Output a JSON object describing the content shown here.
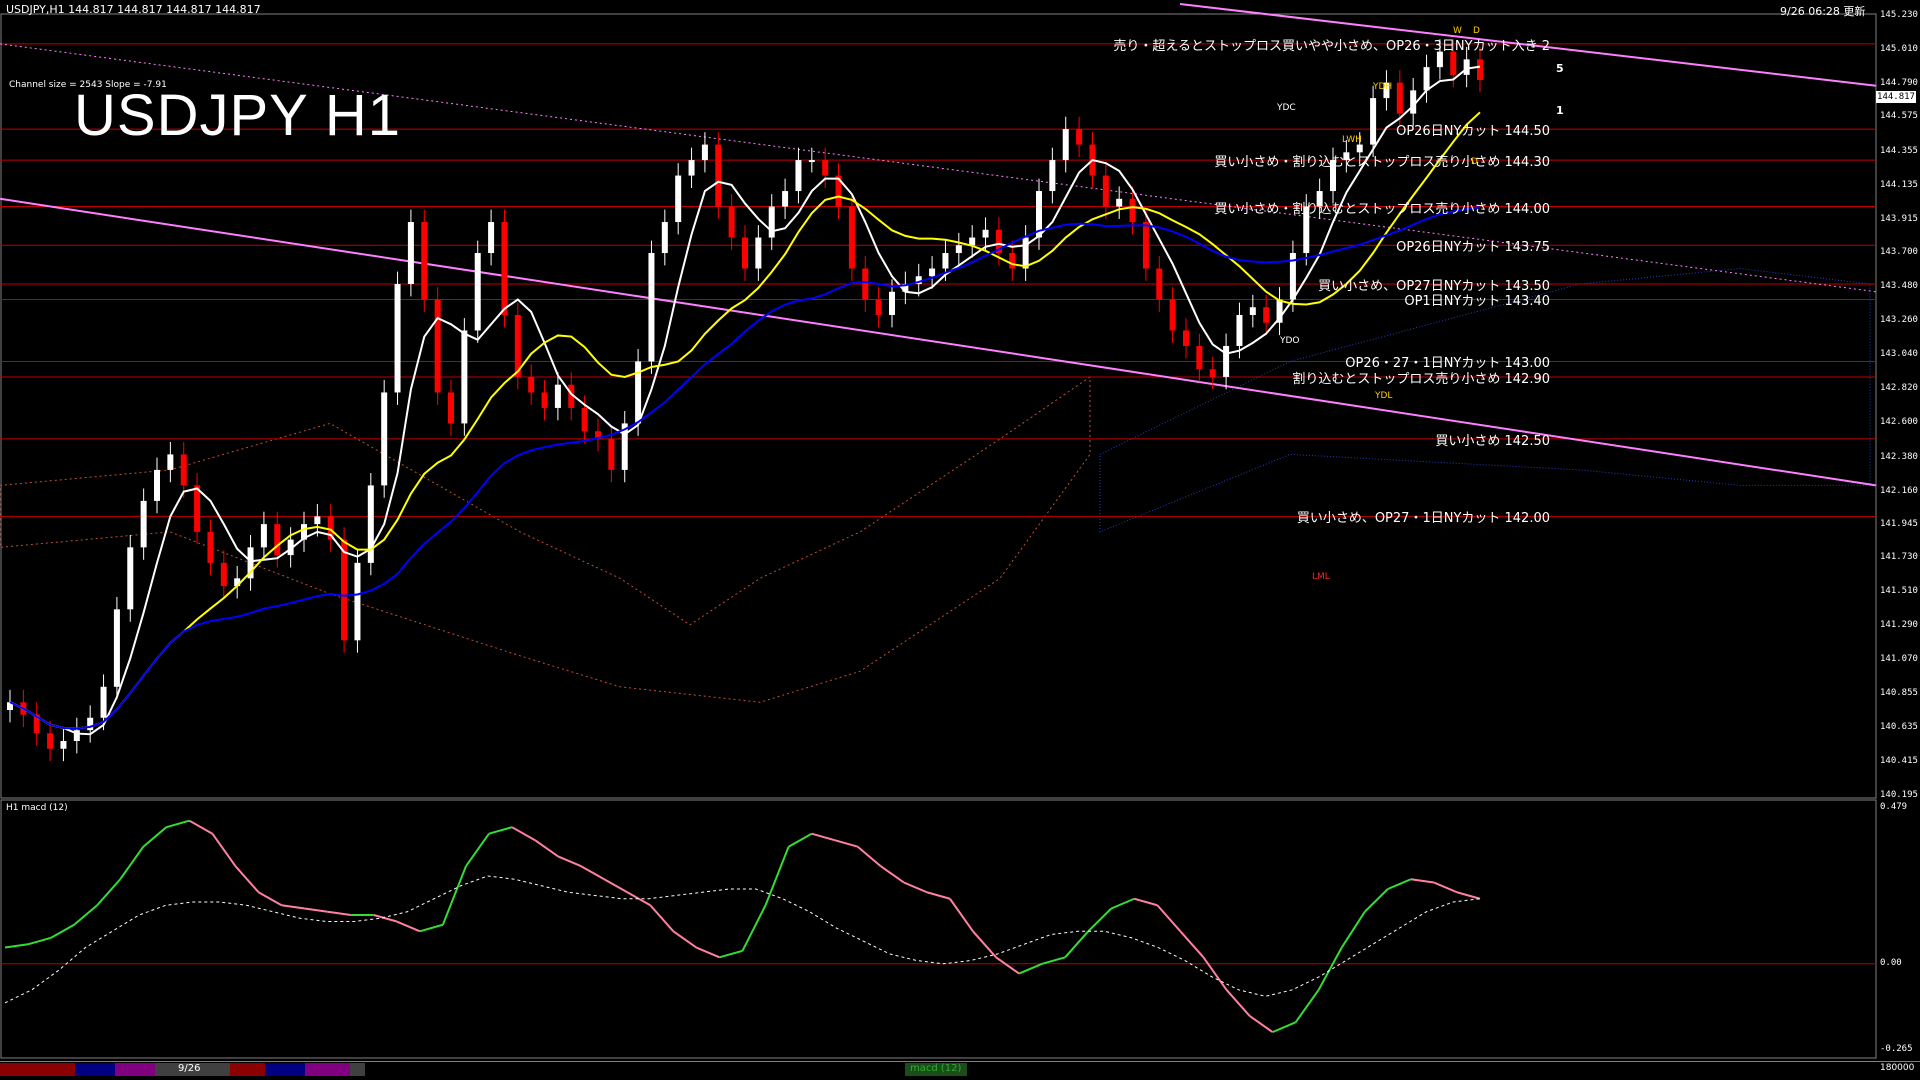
{
  "header": {
    "symbol_line": "USDJPY,H1  144.817 144.817 144.817 144.817",
    "datetime": "9/26 06:28 更新",
    "channel_info": "Channel size = 2543 Slope = -7.91",
    "big_title": "USDJPY H1",
    "current_price": "144.817"
  },
  "price_axis": {
    "ticks": [
      "145.230",
      "145.010",
      "144.790",
      "144.575",
      "144.355",
      "144.135",
      "143.915",
      "143.700",
      "143.480",
      "143.260",
      "143.040",
      "142.820",
      "142.600",
      "142.380",
      "142.160",
      "141.945",
      "141.730",
      "141.510",
      "141.290",
      "141.070",
      "140.855",
      "140.635",
      "140.415",
      "140.195"
    ]
  },
  "macd_axis": {
    "title": "H1  macd (12)",
    "ticks": [
      "0.479",
      "0.00",
      "-0.265"
    ]
  },
  "annotations": [
    {
      "text": "売り・超えるとストップロス買いやや小さめ、OP26・3日NYカット入き  2",
      "price": 145.05
    },
    {
      "text": "OP26日NYカット 144.50",
      "price": 144.5
    },
    {
      "text": "買い小さめ・割り込むとストップロス売り小さめ 144.30",
      "price": 144.3
    },
    {
      "text": "買い小さめ・割り込むとストップロス売り小さめ 144.00",
      "price": 144.0
    },
    {
      "text": "OP26日NYカット 143.75",
      "price": 143.75
    },
    {
      "text": "買い小さめ、OP27日NYカット 143.50",
      "price": 143.5
    },
    {
      "text": "OP1日NYカット 143.40",
      "price": 143.4
    },
    {
      "text": "OP26・27・1日NYカット 143.00",
      "price": 143.0
    },
    {
      "text": "割り込むとストップロス売り小さめ 142.90",
      "price": 142.9
    },
    {
      "text": "買い小さめ 142.50",
      "price": 142.5
    },
    {
      "text": "買い小さめ、OP27・1日NYカット 142.00",
      "price": 142.0
    }
  ],
  "level_labels": [
    "5",
    "1"
  ],
  "box_labels": [
    "YDC",
    "YDH",
    "LWH",
    "YDO",
    "YDL",
    "LML",
    "W",
    "D",
    "D"
  ],
  "tabs": {
    "date_tab": "9/26",
    "indicator_tab": "macd (12)",
    "volume": "180000"
  },
  "colors": {
    "background": "#000000",
    "bull_candle": "#ffffff",
    "bear_candle": "#ff0000",
    "sma_short": "#ffffff",
    "sma_mid": "#ffff00",
    "sma_long": "#0000ff",
    "channel": "#ff80ff",
    "level_line": "#c00000",
    "macd_up": "#33dd33",
    "macd_down": "#ff80a0",
    "kumo_red": "#c05030",
    "kumo_blue": "#2040c0"
  },
  "chart_data": {
    "type": "candlestick",
    "x": "hourly bars",
    "ylim": [
      140.195,
      145.23
    ],
    "closes": [
      140.8,
      140.72,
      140.6,
      140.5,
      140.55,
      140.62,
      140.7,
      140.9,
      141.4,
      141.8,
      142.1,
      142.3,
      142.4,
      142.2,
      141.9,
      141.7,
      141.55,
      141.6,
      141.8,
      141.95,
      141.75,
      141.85,
      141.95,
      142.0,
      141.85,
      141.2,
      141.7,
      142.2,
      142.8,
      143.5,
      143.9,
      143.4,
      142.8,
      142.6,
      143.2,
      143.7,
      143.9,
      143.3,
      142.9,
      142.8,
      142.7,
      142.85,
      142.7,
      142.55,
      142.5,
      142.3,
      142.6,
      143.0,
      143.7,
      143.9,
      144.2,
      144.3,
      144.4,
      144.0,
      143.8,
      143.6,
      143.8,
      144.0,
      144.1,
      144.3,
      144.3,
      144.2,
      144.0,
      143.6,
      143.4,
      143.3,
      143.45,
      143.5,
      143.55,
      143.6,
      143.7,
      143.75,
      143.8,
      143.85,
      143.7,
      143.6,
      143.8,
      144.1,
      144.3,
      144.5,
      144.4,
      144.2,
      144.0,
      144.05,
      143.9,
      143.6,
      143.4,
      143.2,
      143.1,
      142.95,
      142.9,
      143.1,
      143.3,
      143.35,
      143.25,
      143.4,
      143.7,
      144.0,
      144.1,
      144.3,
      144.35,
      144.4,
      144.7,
      144.8,
      144.6,
      144.75,
      144.9,
      145.0,
      144.85,
      144.95,
      144.817
    ],
    "macd": {
      "line": [
        0.05,
        0.06,
        0.08,
        0.12,
        0.18,
        0.26,
        0.36,
        0.42,
        0.44,
        0.4,
        0.3,
        0.22,
        0.18,
        0.17,
        0.16,
        0.15,
        0.15,
        0.13,
        0.1,
        0.12,
        0.3,
        0.4,
        0.42,
        0.38,
        0.33,
        0.3,
        0.26,
        0.22,
        0.18,
        0.1,
        0.05,
        0.02,
        0.04,
        0.18,
        0.36,
        0.4,
        0.38,
        0.36,
        0.3,
        0.25,
        0.22,
        0.2,
        0.1,
        0.02,
        -0.03,
        0.0,
        0.02,
        0.1,
        0.17,
        0.2,
        0.18,
        0.1,
        0.02,
        -0.08,
        -0.16,
        -0.21,
        -0.18,
        -0.08,
        0.05,
        0.16,
        0.23,
        0.26,
        0.25,
        0.22,
        0.2
      ],
      "signal": [
        -0.12,
        -0.08,
        -0.02,
        0.05,
        0.1,
        0.15,
        0.18,
        0.19,
        0.19,
        0.18,
        0.16,
        0.14,
        0.13,
        0.13,
        0.14,
        0.16,
        0.2,
        0.24,
        0.27,
        0.26,
        0.24,
        0.22,
        0.21,
        0.2,
        0.2,
        0.21,
        0.22,
        0.23,
        0.23,
        0.2,
        0.16,
        0.11,
        0.07,
        0.03,
        0.01,
        0.0,
        0.01,
        0.03,
        0.06,
        0.09,
        0.1,
        0.1,
        0.08,
        0.05,
        0.01,
        -0.04,
        -0.08,
        -0.1,
        -0.08,
        -0.04,
        0.01,
        0.06,
        0.11,
        0.16,
        0.19,
        0.2
      ],
      "ylim": [
        -0.265,
        0.479
      ]
    }
  }
}
